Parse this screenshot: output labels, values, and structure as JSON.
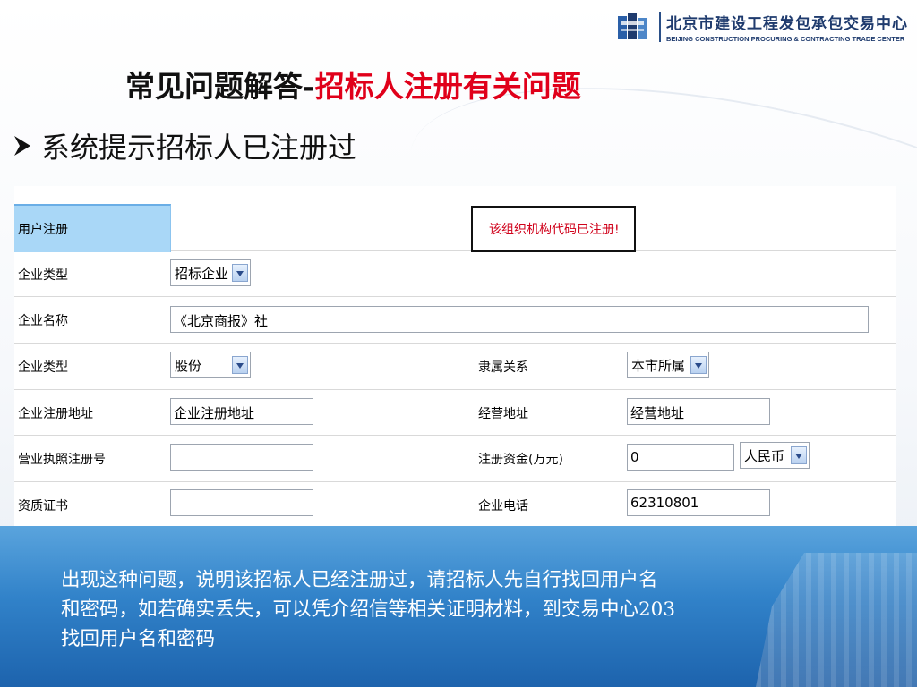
{
  "logo": {
    "name_cn": "北京市建设工程发包承包交易中心",
    "name_en": "BEIJING CONSTRUCTION PROCURING & CONTRACTING TRADE CENTER"
  },
  "title": {
    "black_part": "常见问题解答-",
    "red_part": "招标人注册有关问题"
  },
  "bullet": {
    "text": "系统提示招标人已注册过"
  },
  "form": {
    "header_label": "用户注册",
    "error_message": "该组织机构代码已注册!",
    "rows": {
      "enterprise_type_label": "企业类型",
      "enterprise_type_value": "招标企业",
      "enterprise_name_label": "企业名称",
      "enterprise_name_value": "《北京商报》社",
      "company_type_label": "企业类型",
      "company_type_value": "股份",
      "affiliation_label": "隶属关系",
      "affiliation_value": "本市所属",
      "reg_address_label": "企业注册地址",
      "reg_address_value": "企业注册地址",
      "biz_address_label": "经营地址",
      "biz_address_value": "经营地址",
      "license_label": "营业执照注册号",
      "license_value": "",
      "capital_label": "注册资金(万元)",
      "capital_value": "0",
      "currency_value": "人民币",
      "cert_label": "资质证书",
      "cert_value": "",
      "phone_label": "企业电话",
      "phone_value": "62310801"
    }
  },
  "explanation": {
    "line1": "出现这种问题，说明该招标人已经注册过，请招标人先自行找回用户名",
    "line2": "和密码，如若确实丢失，可以凭介绍信等相关证明材料，到交易中心203",
    "line3": "找回用户名和密码"
  },
  "colors": {
    "title_red": "#e0001a",
    "header_cell": "#a9d7f7",
    "error_text": "#d0021b",
    "band_blue": "#3182c9"
  }
}
